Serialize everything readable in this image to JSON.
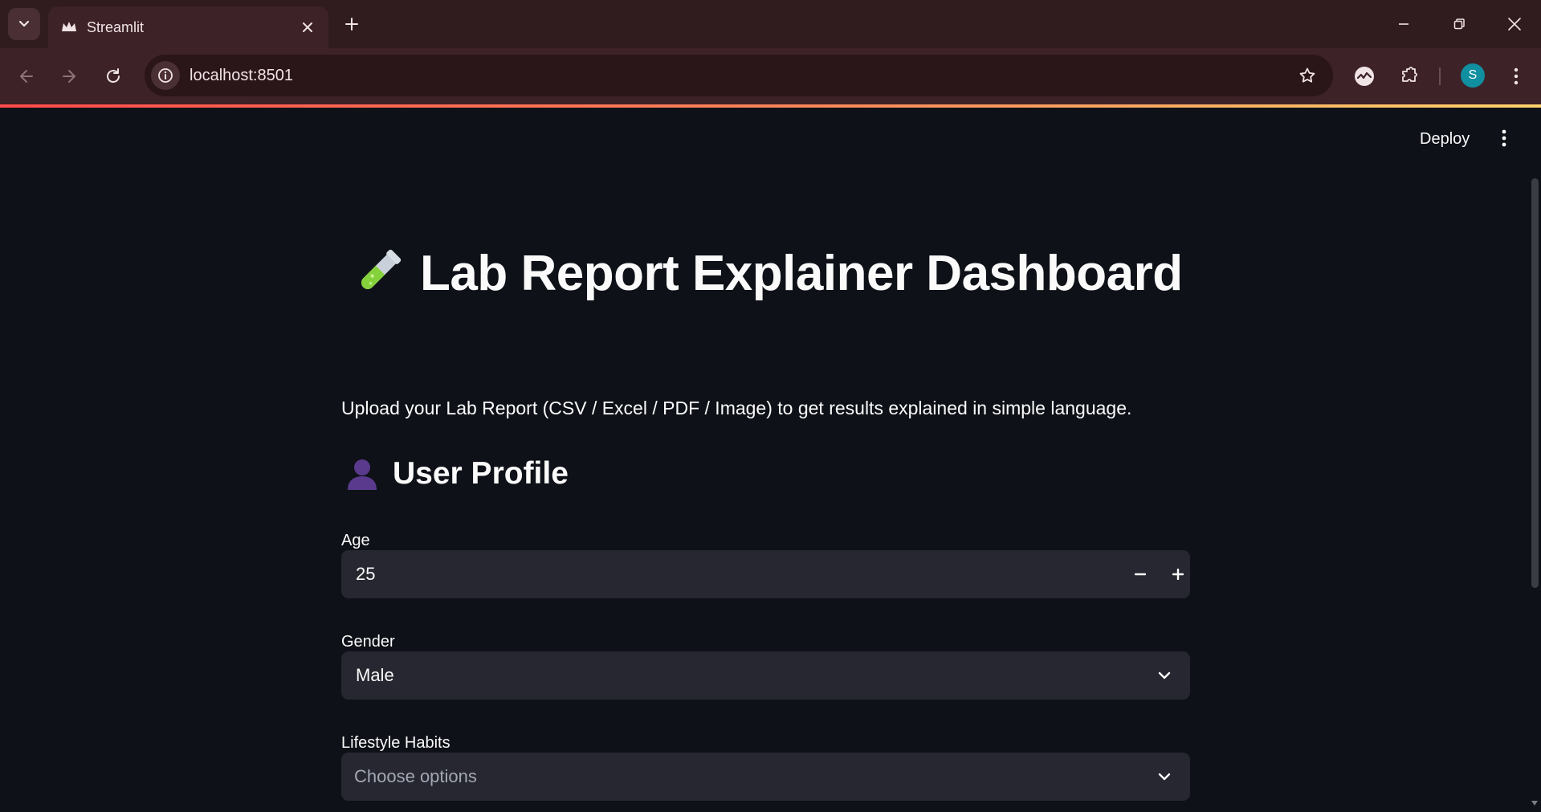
{
  "browser": {
    "tab_title": "Streamlit",
    "url": "localhost:8501",
    "profile_initial": "S"
  },
  "app": {
    "deploy_label": "Deploy",
    "title": "Lab Report Explainer Dashboard",
    "title_icon": "test-tube-icon",
    "intro": "Upload your Lab Report (CSV / Excel / PDF / Image) to get results explained in simple language.",
    "profile_header": "User Profile",
    "profile_icon": "user-silhouette-icon",
    "age": {
      "label": "Age",
      "value": "25"
    },
    "gender": {
      "label": "Gender",
      "value": "Male"
    },
    "lifestyle": {
      "label": "Lifestyle Habits",
      "placeholder": "Choose options"
    }
  },
  "colors": {
    "background": "#0e1117",
    "widget": "#262730",
    "accent": "#ff4b4b",
    "chrome": "#3d2228"
  }
}
